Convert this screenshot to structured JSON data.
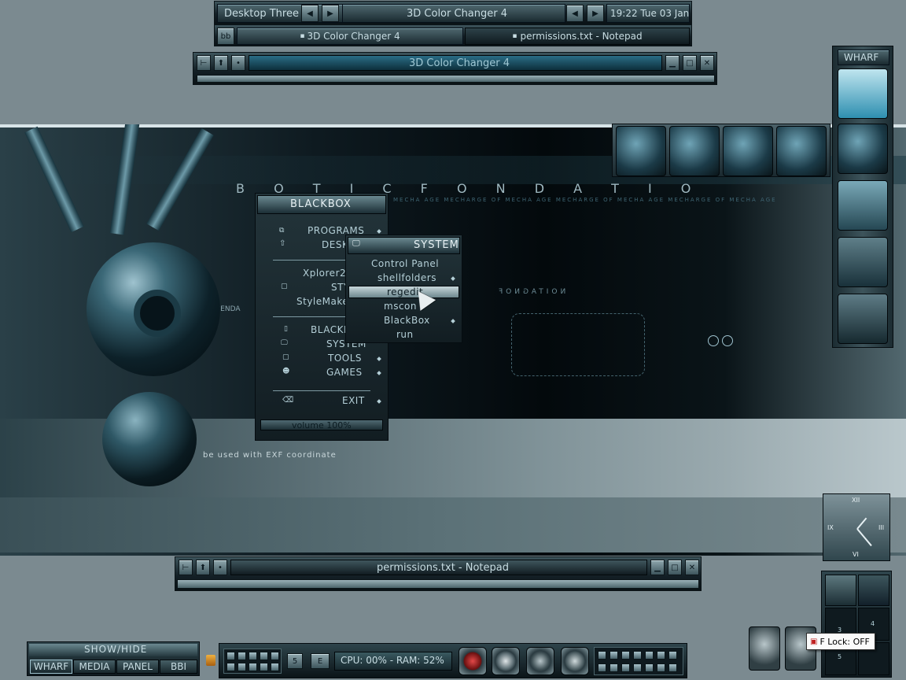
{
  "top_bar": {
    "workspace": "Desktop Three",
    "current_window": "3D Color Changer 4",
    "clock": "19:22 Tue 03 Jan",
    "bb_button": "bb",
    "tasks": [
      "3D Color Changer 4",
      "permissions.txt - Notepad"
    ]
  },
  "window_3d": {
    "title": "3D Color Changer 4"
  },
  "window_notepad": {
    "title": "permissions.txt - Notepad"
  },
  "wallpaper": {
    "heading": "B O T I C F O N D A T I O",
    "subline": "MECHA AGE MECHARGE OF MECHA AGE MECHARGE OF MECHA AGE MECHARGE OF MECHA AGE",
    "ascend": "ASCENDA",
    "caption": "be used with EXF coordinate",
    "side_text": "NOITAGNOF"
  },
  "blackbox_menu": {
    "title": "BLACKBOX",
    "items": [
      "PROGRAMS",
      "DESK",
      "Xplorer2",
      "STY",
      "StyleMaker",
      "BLACKB",
      "SYSTEM",
      "TOOLS",
      "GAMES",
      "EXIT"
    ],
    "volume": "volume 100%"
  },
  "system_menu": {
    "title": "SYSTEM",
    "items": [
      "Control Panel",
      "shellfolders",
      "regedit",
      "mscon",
      "BlackBox",
      "run"
    ]
  },
  "wharf": {
    "title": "WHARF"
  },
  "clock_numerals": [
    "XII",
    "III",
    "VI",
    "IX"
  ],
  "pager": {
    "desks": [
      "3",
      "4",
      "5"
    ]
  },
  "bottom_left": {
    "title": "SHOW/HIDE",
    "buttons": [
      "WHARF",
      "MEDIA",
      "PANEL",
      "BBI"
    ]
  },
  "bottom_panel": {
    "stats": "CPU: 00% - RAM: 52%",
    "small_btns": [
      "5",
      "E"
    ]
  },
  "tooltip": {
    "text": "F Lock: OFF"
  },
  "accent": "#2e8fb0"
}
